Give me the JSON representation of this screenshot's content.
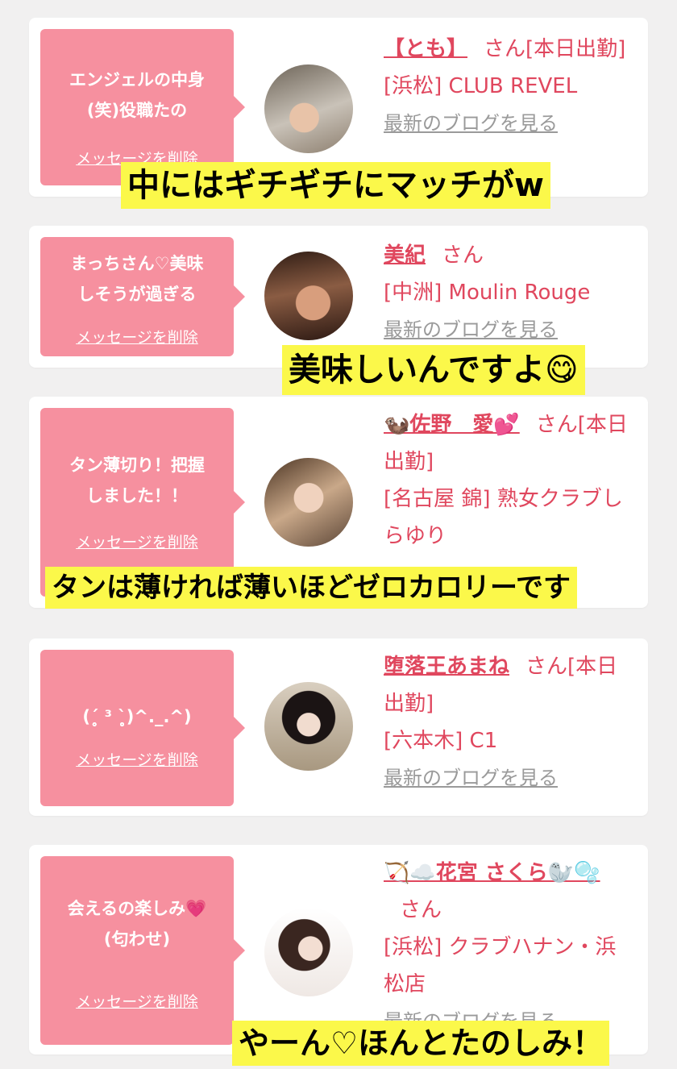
{
  "cards": [
    {
      "message": "エンジェルの中身\n(笑)役職たの",
      "delete_label": "メッセージを削除",
      "name": "【とも】",
      "honorific": "さん[本日出勤]",
      "location": "[浜松] CLUB REVEL",
      "blog": "最新のブログを見る"
    },
    {
      "message": "まっちさん♡美味\nしそうが過ぎる",
      "delete_label": "メッセージを削除",
      "name": "美紀",
      "honorific": "さん",
      "location": "[中洲] Moulin Rouge",
      "blog": "最新のブログを見る"
    },
    {
      "message": "タン薄切り！把握\nしました！！",
      "delete_label": "メッセージを削除",
      "name": "🦦佐野　愛💕",
      "honorific": "さん[本日出勤]",
      "location": "[名古屋 錦] 熟女クラブしらゆり",
      "blog": ""
    },
    {
      "message": "(ˊ̥̥̥̥̥ ³ ˋ̥̥̥̥̥)^._.^)",
      "delete_label": "メッセージを削除",
      "name": "堕落王あまね",
      "honorific": "さん[本日出勤]",
      "location": "[六本木] C1",
      "blog": "最新のブログを見る"
    },
    {
      "message": "会えるの楽しみ💗\n(匂わせ)",
      "delete_label": "メッセージを削除",
      "name": "🏹☁️花宮 さくら🦭🫧",
      "honorific": "さん",
      "location": "[浜松] クラブハナン・浜松店",
      "blog": "最新のブログを見る"
    }
  ],
  "captions": [
    "中にはギチギチにマッチがw",
    "美味しいんですよ😋",
    "タンは薄ければ薄いほどゼロカロリーです",
    "やーん♡ほんとたのしみ！"
  ]
}
